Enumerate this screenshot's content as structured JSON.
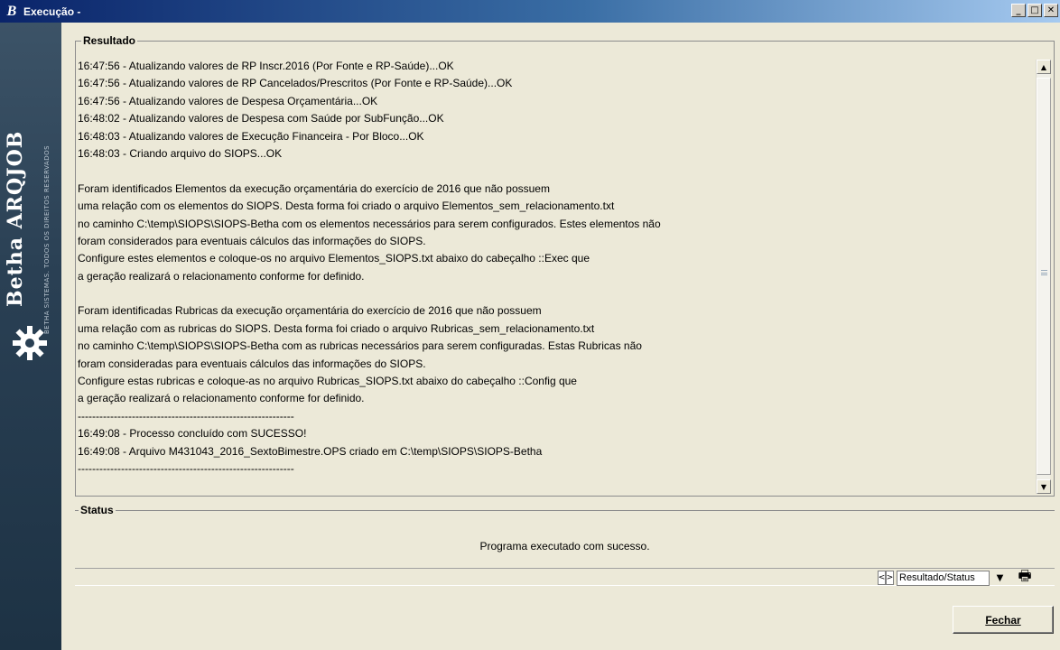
{
  "window": {
    "title": "Execução -",
    "logo_letter": "B"
  },
  "brand": {
    "name": "Betha ARQJOB",
    "tagline": "BETHA SISTEMAS. TODOS OS DIREITOS RESERVADOS"
  },
  "result": {
    "label": "Resultado",
    "lines": [
      "16:47:56 - Atualizando valores de RP Inscr.2016 (Por Fonte e RP-Saúde)...OK",
      "16:47:56 - Atualizando valores de RP Cancelados/Prescritos (Por Fonte e RP-Saúde)...OK",
      "16:47:56 - Atualizando valores de Despesa Orçamentária...OK",
      "16:48:02 - Atualizando valores de Despesa com Saúde por SubFunção...OK",
      "16:48:03 - Atualizando valores de Execução Financeira - Por Bloco...OK",
      "16:48:03 - Criando arquivo do SIOPS...OK",
      "",
      "Foram identificados Elementos da execução orçamentária do exercício de 2016 que não possuem",
      "uma relação com os elementos do SIOPS. Desta forma foi criado o arquivo Elementos_sem_relacionamento.txt",
      "no caminho C:\\temp\\SIOPS\\SIOPS-Betha com os elementos necessários para serem configurados. Estes elementos não",
      "foram considerados para eventuais cálculos das informações do SIOPS.",
      "Configure estes elementos e coloque-os no arquivo Elementos_SIOPS.txt abaixo do cabeçalho ::Exec que",
      "a geração realizará o relacionamento conforme for definido.",
      "",
      "Foram identificadas Rubricas da execução orçamentária do exercício de 2016 que não possuem",
      "uma relação com as rubricas do SIOPS. Desta forma foi criado o arquivo Rubricas_sem_relacionamento.txt",
      "no caminho C:\\temp\\SIOPS\\SIOPS-Betha com as rubricas necessários para serem configuradas. Estas Rubricas não",
      "foram consideradas para eventuais cálculos das informações do SIOPS.",
      "Configure estas rubricas e coloque-as no arquivo Rubricas_SIOPS.txt abaixo do cabeçalho ::Config que",
      "a geração realizará o relacionamento conforme for definido.",
      "------------------------------------------------------------",
      "16:49:08 - Processo concluído com SUCESSO!",
      "16:49:08 - Arquivo M431043_2016_SextoBimestre.OPS criado em C:\\temp\\SIOPS\\SIOPS-Betha",
      "------------------------------------------------------------"
    ]
  },
  "status": {
    "label": "Status",
    "message": "Programa executado com sucesso."
  },
  "statusbar": {
    "prev": "<",
    "next": ">",
    "view_selected": "Resultado/Status"
  },
  "buttons": {
    "close_label": "Fechar"
  }
}
